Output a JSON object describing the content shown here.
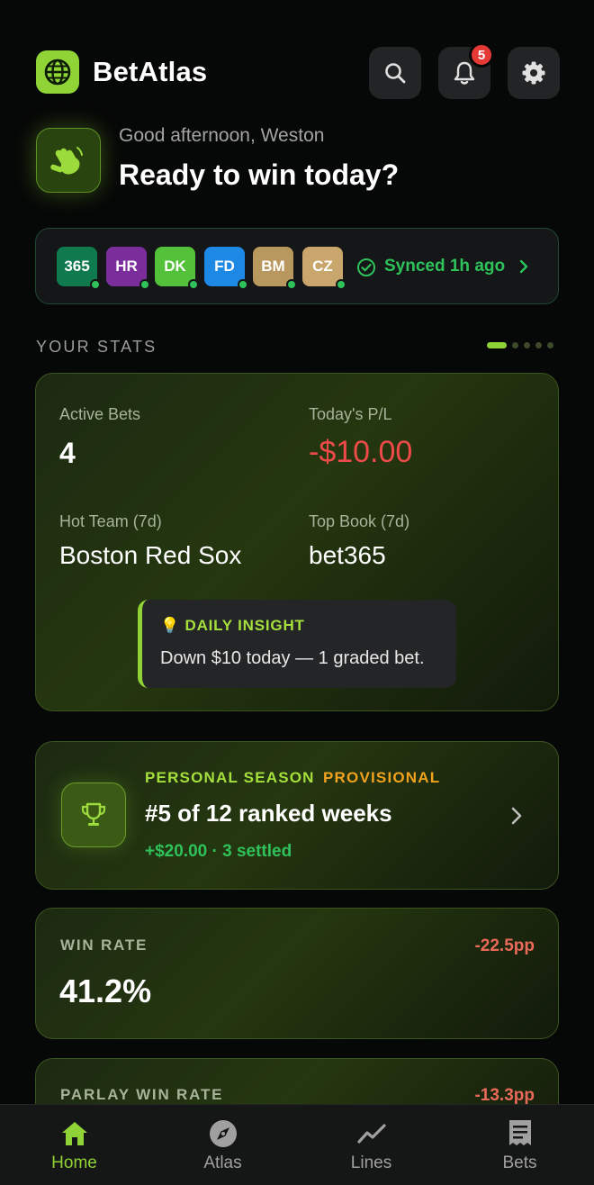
{
  "app": {
    "title": "BetAtlas",
    "logo_icon": "globe-icon"
  },
  "header": {
    "notification_count": "5"
  },
  "greeting": {
    "subtitle": "Good afternoon, Weston",
    "title": "Ready to win today?",
    "icon": "waving-hand-icon"
  },
  "sync": {
    "books": [
      {
        "label": "365",
        "color": "#0e7a4e"
      },
      {
        "label": "HR",
        "color": "#7b2d9c"
      },
      {
        "label": "DK",
        "color": "#53c23a"
      },
      {
        "label": "FD",
        "color": "#1e88e5"
      },
      {
        "label": "BM",
        "color": "#b8985e"
      },
      {
        "label": "CZ",
        "color": "#c9a66b"
      }
    ],
    "status": "Synced 1h ago"
  },
  "stats": {
    "section_label": "YOUR STATS",
    "active_bets_label": "Active Bets",
    "active_bets_value": "4",
    "pl_label": "Today's P/L",
    "pl_value": "-$10.00",
    "hot_team_label": "Hot Team (7d)",
    "hot_team_value": "Boston Red Sox",
    "top_book_label": "Top Book (7d)",
    "top_book_value": "bet365",
    "insight_title": "DAILY INSIGHT",
    "insight_text": "Down $10 today — 1 graded bet."
  },
  "season": {
    "label": "PERSONAL SEASON",
    "tag": "PROVISIONAL",
    "title": "#5 of 12 ranked weeks",
    "subtitle": "+$20.00 · 3 settled"
  },
  "win_rate": {
    "label": "WIN RATE",
    "value": "41.2%",
    "delta": "-22.5pp"
  },
  "parlay_win_rate": {
    "label": "PARLAY WIN RATE",
    "delta": "-13.3pp"
  },
  "nav": [
    {
      "label": "Home",
      "icon": "home-icon",
      "active": true
    },
    {
      "label": "Atlas",
      "icon": "compass-icon",
      "active": false
    },
    {
      "label": "Lines",
      "icon": "trend-line-icon",
      "active": false
    },
    {
      "label": "Bets",
      "icon": "receipt-icon",
      "active": false
    }
  ],
  "colors": {
    "accent": "#8fd336",
    "positive": "#2fc25b",
    "negative": "#ef4a4a",
    "warning": "#f0a21c"
  }
}
